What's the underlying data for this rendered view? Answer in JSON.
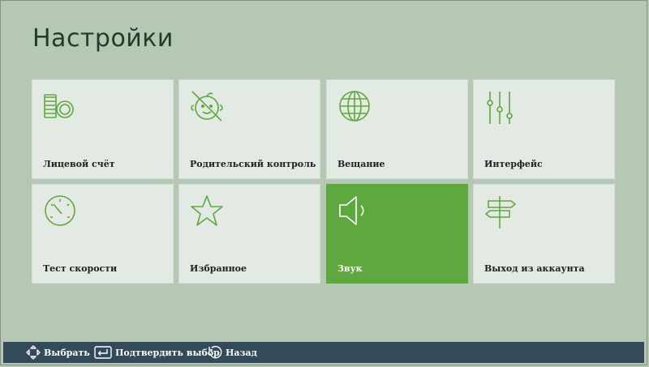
{
  "page": {
    "title": "Настройки"
  },
  "colors": {
    "accent": "#5ea93e",
    "tile_bg": "#e3e9e3",
    "page_bg": "#b4c8b3",
    "bottom_bar": "#334a5a"
  },
  "tiles": [
    {
      "label": "Лицевой счёт",
      "icon": "coins-icon",
      "selected": false
    },
    {
      "label": "Родительский контроль",
      "icon": "child-face-crossed-icon",
      "selected": false
    },
    {
      "label": "Вещание",
      "icon": "globe-icon",
      "selected": false
    },
    {
      "label": "Интерфейс",
      "icon": "sliders-icon",
      "selected": false
    },
    {
      "label": "Тест скорости",
      "icon": "speedometer-icon",
      "selected": false
    },
    {
      "label": "Избранное",
      "icon": "star-icon",
      "selected": false
    },
    {
      "label": "Звук",
      "icon": "speaker-icon",
      "selected": true
    },
    {
      "label": "Выход из аккаунта",
      "icon": "signpost-icon",
      "selected": false
    }
  ],
  "hints": [
    {
      "label": "Выбрать",
      "icon": "dpad-arrows-icon"
    },
    {
      "label": "Подтвердить выбор",
      "icon": "enter-key-icon"
    },
    {
      "label": "Назад",
      "icon": "back-arrow-icon"
    }
  ]
}
